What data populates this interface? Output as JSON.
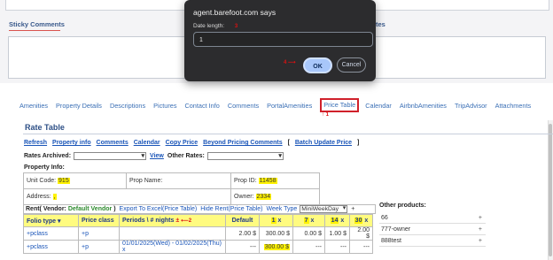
{
  "background": {
    "sticky_comments_label": "Sticky Comments",
    "other_tab_partial": "tes"
  },
  "dialog": {
    "title": "agent.barefoot.com says",
    "label": "Date length:",
    "input_value": "1",
    "ok_label": "OK",
    "cancel_label": "Cancel",
    "annotation_3": "3",
    "annotation_4": "4"
  },
  "tabs": [
    {
      "label": "Amenities"
    },
    {
      "label": "Property Details"
    },
    {
      "label": "Descriptions"
    },
    {
      "label": "Pictures"
    },
    {
      "label": "Contact Info"
    },
    {
      "label": "Comments"
    },
    {
      "label": "PortalAmenities"
    },
    {
      "label": "Price Table",
      "active": true
    },
    {
      "label": "Calendar"
    },
    {
      "label": "AirbnbAmenities"
    },
    {
      "label": "TripAdvisor"
    },
    {
      "label": "Attachments"
    }
  ],
  "annotation_1": "1",
  "annotation_2": "2",
  "rate_table": {
    "title": "Rate Table",
    "links": [
      "Refresh",
      "Property info",
      "Comments",
      "Calendar",
      "Copy Price",
      "Beyond Pricing Comments"
    ],
    "batch_link": "Batch Update Price",
    "bracket_open": "[",
    "bracket_close": "]",
    "rates_archived_label": "Rates Archived:",
    "view_label": "View",
    "other_rates_label": "Other Rates:",
    "property_info_label": "Property Info:",
    "unit_code_label": "Unit Code:",
    "unit_code_value": "915",
    "prop_name_label": "Prop Name:",
    "prop_id_label": "Prop ID:",
    "prop_id_value": "11458",
    "address_label": "Address:",
    "address_value": ",",
    "owner_label": "Owner:",
    "owner_value": "2334",
    "rent_label": "Rent( Vendor:",
    "vendor_value": "Default Vendor",
    "rent_close": ")",
    "export_link": "Export To Excel(Price Table)",
    "hide_link": "Hide Rent(Price Table)",
    "week_type_label": "Week Type",
    "week_type_value": "MiniWeekDay",
    "week_plus": "+",
    "columns": {
      "folio": "Folio type",
      "folio_sort": "▾",
      "price_class": "Price class",
      "periods": "Periods \\ # nights",
      "periods_sort": "±",
      "default": "Default",
      "n1": "1",
      "n7": "7",
      "n14": "14",
      "n30": "30",
      "x": "x"
    },
    "rows": [
      {
        "folio": "+pclass",
        "price_class": "+p",
        "period": "",
        "default": "2.00 $",
        "n1": "300.00 $",
        "n7": "0.00 $",
        "n14": "1.00 $",
        "n30": "2.00 $"
      },
      {
        "folio": "+pclass",
        "price_class": "+p",
        "period": "01/01/2025(Wed) - 01/02/2025(Thu)",
        "x": "x",
        "default": "---",
        "n1": "300.00 $",
        "n7": "---",
        "n14": "---",
        "n30": "---"
      }
    ]
  },
  "other_products": {
    "title": "Other products:",
    "items": [
      {
        "label": "66",
        "plus": "+"
      },
      {
        "label": "777-owner",
        "plus": "+"
      },
      {
        "label": "888test",
        "plus": "+"
      }
    ]
  }
}
